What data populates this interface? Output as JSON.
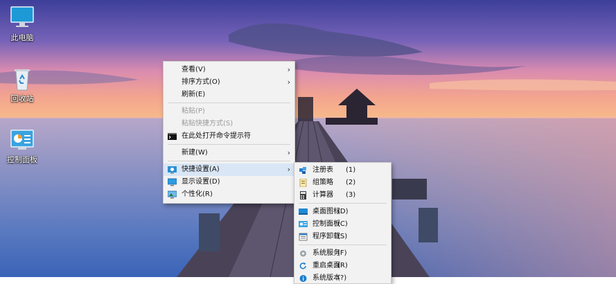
{
  "desktop": {
    "icons": [
      {
        "label": "此电脑",
        "icon": "monitor-icon"
      },
      {
        "label": "回收站",
        "icon": "recycle-bin-icon"
      },
      {
        "label": "控制面板",
        "icon": "control-panel-icon"
      }
    ]
  },
  "context_menu": {
    "items": [
      {
        "label": "查看(V)",
        "has_submenu": true
      },
      {
        "label": "排序方式(O)",
        "has_submenu": true
      },
      {
        "label": "刷新(E)"
      },
      {
        "label": "粘贴(P)",
        "disabled": true
      },
      {
        "label": "粘贴快捷方式(S)",
        "disabled": true
      },
      {
        "label": "在此处打开命令提示符",
        "icon": "command-prompt-icon"
      },
      {
        "label": "新建(W)",
        "has_submenu": true
      },
      {
        "label": "快捷设置(A)",
        "has_submenu": true,
        "active": true,
        "icon": "quick-settings-icon"
      },
      {
        "label": "显示设置(D)",
        "icon": "display-icon"
      },
      {
        "label": "个性化(R)",
        "icon": "personalize-icon"
      }
    ],
    "arrow": "›"
  },
  "submenu": {
    "items": [
      {
        "label": "注册表",
        "key": "(1)",
        "icon": "registry-icon"
      },
      {
        "label": "组策略",
        "key": "(2)",
        "icon": "group-policy-icon"
      },
      {
        "label": "计算器",
        "key": "(3)",
        "icon": "calculator-icon"
      },
      {
        "label": "桌面图标",
        "key": "(D)",
        "icon": "desktop-icon"
      },
      {
        "label": "控制面板",
        "key": "(C)",
        "icon": "control-panel-icon"
      },
      {
        "label": "程序卸载",
        "key": "(S)",
        "icon": "uninstall-icon"
      },
      {
        "label": "系统服务",
        "key": "(F)",
        "icon": "services-icon"
      },
      {
        "label": "重启桌面",
        "key": "(R)",
        "icon": "restart-icon"
      },
      {
        "label": "系统版本",
        "key": "(?)",
        "icon": "info-icon"
      }
    ]
  },
  "colors": {
    "menu_bg": "#f2f2f2",
    "active_bg": "#d9e6f5",
    "disabled_text": "#9a9a9a"
  }
}
